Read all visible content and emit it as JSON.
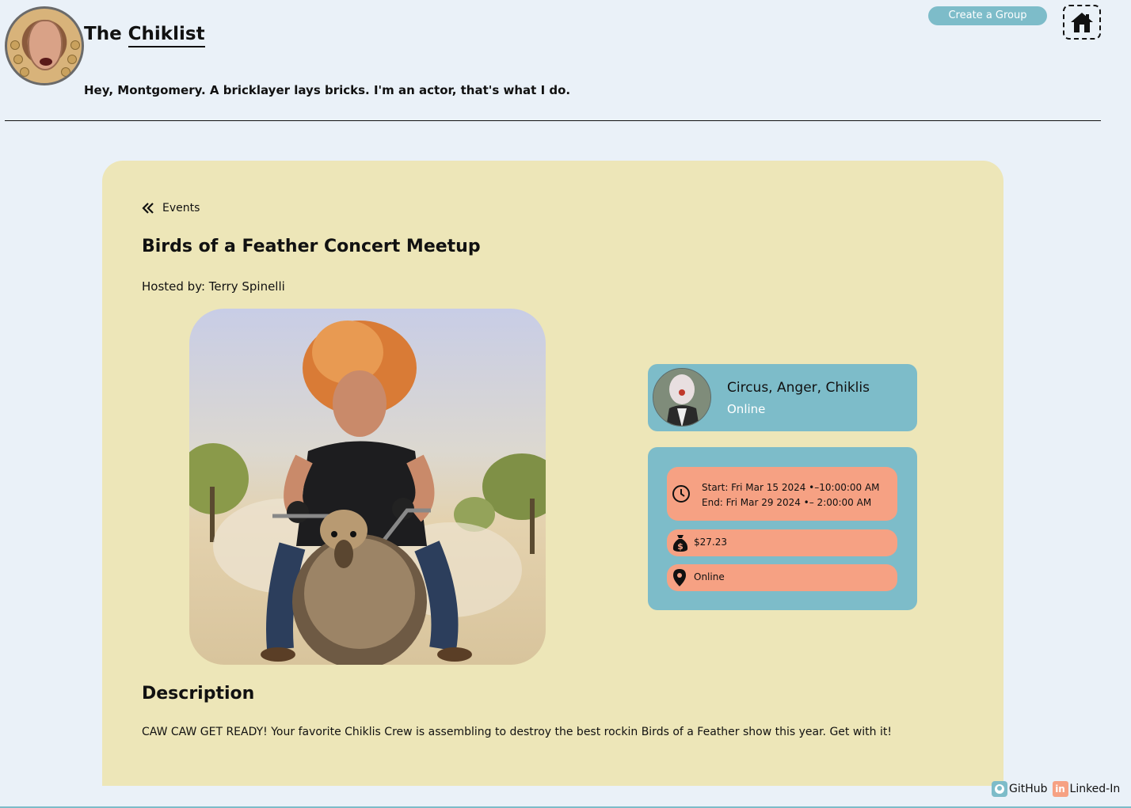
{
  "header": {
    "title_part1": "The ",
    "title_part2": "Chiklist",
    "tagline": "Hey, Montgomery. A bricklayer lays bricks. I'm an actor, that's what I do.",
    "create_group_label": "Create a Group",
    "home_icon": "home-icon"
  },
  "event": {
    "back_label": "Events",
    "title": "Birds of a Feather Concert Meetup",
    "host": "Hosted by: Terry Spinelli",
    "group": {
      "name": "Circus, Anger, Chiklis",
      "type": "Online"
    },
    "start": "Start: Fri Mar 15 2024 •–10:00:00 AM",
    "end": "End: Fri Mar 29 2024 •– 2:00:00 AM",
    "price": "$27.23",
    "location": "Online",
    "description_title": "Description",
    "description": "CAW CAW GET READY! Your favorite Chiklis Crew is assembling to destroy the best rockin Birds of a Feather show this year. Get with it!"
  },
  "footer": {
    "github_label": "GitHub",
    "linkedin_label": "Linked-In"
  },
  "colors": {
    "background": "#eaf1f8",
    "card": "#ede6b8",
    "accent_blue": "#7dbcc9",
    "accent_salmon": "#f6a183"
  }
}
